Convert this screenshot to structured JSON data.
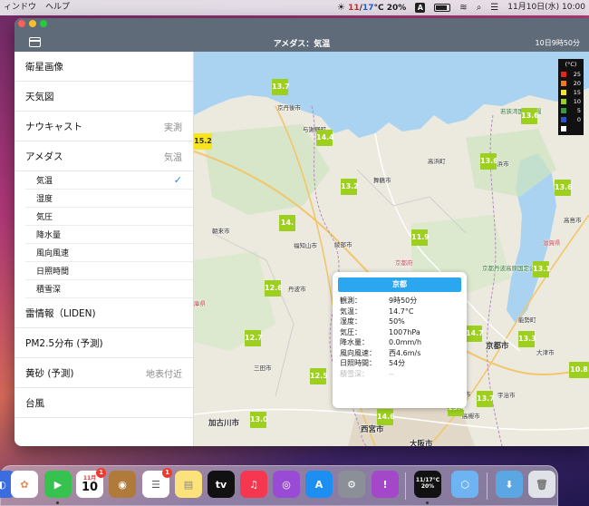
{
  "menubar": {
    "menus": [
      "ィンドウ",
      "ヘルプ"
    ],
    "weather_hi": "11",
    "weather_lo": "17",
    "weather_unit": "°C",
    "weather_pct": "20%",
    "input_badge": "A",
    "datetime": "11月10日(水) 10:00"
  },
  "window": {
    "title": "アメダス：気温",
    "time": "10日9時50分"
  },
  "sidebar": {
    "rows_top": [
      {
        "label": "衛星画像",
        "detail": ""
      },
      {
        "label": "天気図",
        "detail": ""
      },
      {
        "label": "ナウキャスト",
        "detail": "実測"
      },
      {
        "label": "アメダス",
        "detail": "気温"
      }
    ],
    "sub_items": [
      {
        "label": "気温",
        "checked": true
      },
      {
        "label": "湿度",
        "checked": false
      },
      {
        "label": "気圧",
        "checked": false
      },
      {
        "label": "降水量",
        "checked": false
      },
      {
        "label": "風向風速",
        "checked": false
      },
      {
        "label": "日照時間",
        "checked": false
      },
      {
        "label": "積雪深",
        "checked": false
      }
    ],
    "check_glyph": "✓",
    "rows_bottom": [
      {
        "label": "雷情報（LIDEN)",
        "detail": ""
      },
      {
        "label": "PM2.5分布 (予測)",
        "detail": ""
      },
      {
        "label": "黄砂 (予測)",
        "detail": "地表付近"
      },
      {
        "label": "台風",
        "detail": ""
      }
    ]
  },
  "map": {
    "legend": {
      "unit": "(°C)",
      "entries": [
        {
          "value": "25",
          "color": "#e8231f"
        },
        {
          "value": "20",
          "color": "#f07a1c"
        },
        {
          "value": "15",
          "color": "#f7e51b"
        },
        {
          "value": "10",
          "color": "#9ccf1e"
        },
        {
          "value": "5",
          "color": "#3a9a3a"
        },
        {
          "value": "0",
          "color": "#2a55c8"
        },
        {
          "value": "",
          "color": "#ffffff"
        }
      ]
    },
    "temps": [
      {
        "v": "13.7",
        "color": "#9ccf1e"
      },
      {
        "v": "15.2",
        "color": "#f7e51b"
      },
      {
        "v": "14.4",
        "color": "#9ccf1e"
      },
      {
        "v": "13.2",
        "color": "#9ccf1e"
      },
      {
        "v": "13.6",
        "color": "#9ccf1e"
      },
      {
        "v": "13.6",
        "color": "#9ccf1e"
      },
      {
        "v": "13.6",
        "color": "#9ccf1e"
      },
      {
        "v": "14.",
        "color": "#9ccf1e"
      },
      {
        "v": "11.9",
        "color": "#9ccf1e"
      },
      {
        "v": "13.1",
        "color": "#9ccf1e"
      },
      {
        "v": "12.6",
        "color": "#9ccf1e"
      },
      {
        "v": "12.7",
        "color": "#9ccf1e"
      },
      {
        "v": "12.5",
        "color": "#9ccf1e"
      },
      {
        "v": "14.7",
        "color": "#9ccf1e"
      },
      {
        "v": "13.3",
        "color": "#9ccf1e"
      },
      {
        "v": "10.8",
        "color": "#9ccf1e"
      },
      {
        "v": "13.7",
        "color": "#9ccf1e"
      },
      {
        "v": "13.4",
        "color": "#9ccf1e"
      },
      {
        "v": "14.6",
        "color": "#9ccf1e"
      },
      {
        "v": "13.0",
        "color": "#9ccf1e"
      }
    ],
    "places": {
      "kyotango": "京丹後市",
      "yosano": "与謝野町",
      "maizuru": "舞鶴市",
      "wakasa": "若狭湾国定公園",
      "takahama": "高浜町",
      "obama": "小浜市",
      "asago": "朝来市",
      "fukuchiyama": "福知山市",
      "ayabe": "綾部市",
      "kyotofu": "京都府",
      "kyotosub": "京都丹波高原国定公園",
      "tanba": "丹波市",
      "hyogo": "庫県",
      "sanda": "三田市",
      "kyoto": "京都市",
      "otsu": "大津市",
      "uji": "宇治市",
      "kasai": "加古川市",
      "kameoka": "亀岡市",
      "takatsuki": "高槻市",
      "nishinomiya": "西宮市",
      "osaka": "大阪市",
      "takashima": "高島市",
      "shiga": "滋賀県",
      "biwako": "琵琶湖",
      "nose": "能勢町"
    },
    "popup": {
      "title": "京都",
      "rows": [
        {
          "k": "観測：",
          "v": "9時50分",
          "dim": false
        },
        {
          "k": "気温：",
          "v": "14.7°C",
          "dim": false
        },
        {
          "k": "湿度：",
          "v": "50%",
          "dim": false
        },
        {
          "k": "気圧：",
          "v": "1007hPa",
          "dim": false
        },
        {
          "k": "降水量：",
          "v": "0.0mm/h",
          "dim": false
        },
        {
          "k": "風向風速：",
          "v": "西4.6m/s",
          "dim": false
        },
        {
          "k": "日照時間：",
          "v": "54分",
          "dim": false
        },
        {
          "k": "積雪深：",
          "v": "--",
          "dim": true
        }
      ]
    }
  },
  "dock": {
    "calendar_month": "11月",
    "calendar_day": "10",
    "calendar_badge": "1",
    "reminders_badge": "1",
    "tv_label": "tv",
    "weather_widget_temp": "20%",
    "weather_widget_range": "11/17°C"
  }
}
